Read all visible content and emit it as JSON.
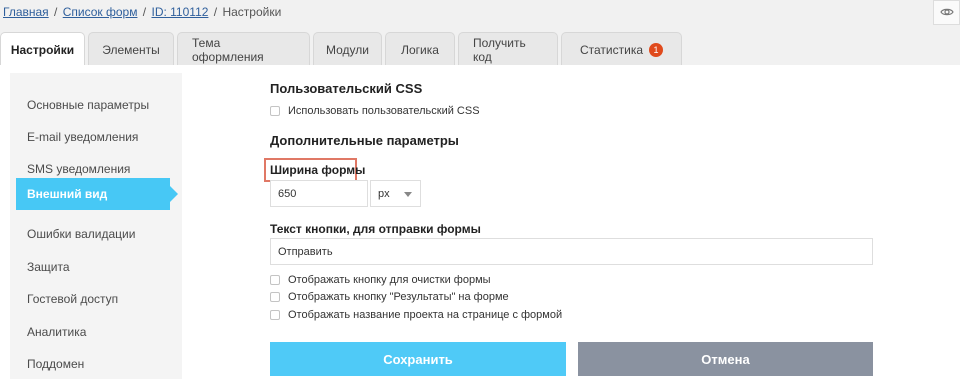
{
  "breadcrumb": {
    "home": "Главная",
    "forms": "Список форм",
    "id": "ID: 110112",
    "current": "Настройки",
    "separator": "/"
  },
  "tabs": [
    {
      "label": "Настройки",
      "active": true
    },
    {
      "label": "Элементы"
    },
    {
      "label": "Тема оформления"
    },
    {
      "label": "Модули"
    },
    {
      "label": "Логика"
    },
    {
      "label": "Получить код"
    },
    {
      "label": "Статистика",
      "badge": "1"
    }
  ],
  "sidebar": {
    "items": [
      {
        "label": "Основные параметры"
      },
      {
        "label": "E-mail уведомления"
      },
      {
        "label": "SMS уведомления"
      },
      {
        "label": "Внешний вид",
        "active": true
      },
      {
        "label": "Ошибки валидации"
      },
      {
        "label": "Защита"
      },
      {
        "label": "Гостевой доступ"
      },
      {
        "label": "Аналитика"
      },
      {
        "label": "Поддомен"
      }
    ]
  },
  "custom_css": {
    "title": "Пользовательский CSS",
    "checkbox_label": "Использовать пользовательский CSS"
  },
  "additional": {
    "title": "Дополнительные параметры",
    "width_label": "Ширина формы",
    "width_value": "650",
    "unit_value": "px",
    "button_text_label": "Текст кнопки, для отправки формы",
    "button_text_value": "Отправить",
    "checkboxes": [
      "Отображать кнопку для очистки формы",
      "Отображать кнопку \"Результаты\" на форме",
      "Отображать название проекта на странице с формой"
    ]
  },
  "actions": {
    "save": "Сохранить",
    "cancel": "Отмена"
  },
  "colors": {
    "accent": "#47c8f5",
    "save_button": "#4fcaf7",
    "cancel_button": "#8a92a0",
    "badge": "#e04a1c",
    "highlight": "#e07865"
  },
  "icons": {
    "preview": "eye-icon"
  }
}
